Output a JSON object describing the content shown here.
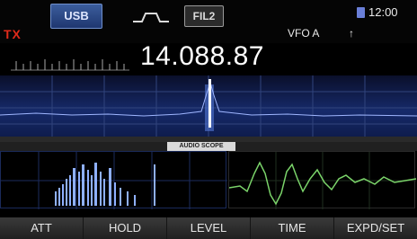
{
  "status": {
    "tx": "TX",
    "mode": "USB",
    "filter": "FIL2",
    "vfo": "VFO A",
    "vfo_mark": "↑",
    "clock": "12:00"
  },
  "frequency": "14.088.87",
  "scope": {
    "title": "AUDIO SCOPE"
  },
  "softkeys": [
    "ATT",
    "HOLD",
    "LEVEL",
    "TIME",
    "EXPD/SET"
  ],
  "colors": {
    "tx": "#e02a1a",
    "mode_bg": "#2f4d8c",
    "spectrum_bg": "#162a6a"
  }
}
